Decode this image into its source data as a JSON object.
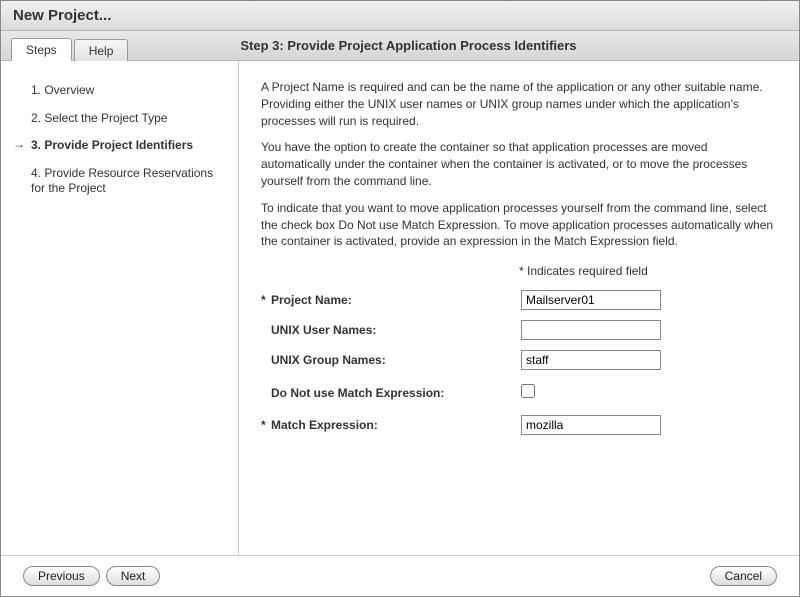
{
  "window": {
    "title": "New Project..."
  },
  "tabs": {
    "steps": "Steps",
    "help": "Help"
  },
  "stepTitle": "Step 3:   Provide Project Application Process Identifiers",
  "sidebar": {
    "items": [
      {
        "label": "1.  Overview"
      },
      {
        "label": "2.  Select the Project Type"
      },
      {
        "label": "3.  Provide Project Identifiers"
      },
      {
        "label": "4.  Provide Resource Reservations for the Project"
      }
    ]
  },
  "desc": {
    "p1": "A Project Name is required and can be the name of the application or any other suitable name. Providing either the UNIX user names or UNIX group names under which the application's processes will run is required.",
    "p2": "You have the option to create the container so that application processes are moved automatically under the container when the container is activated, or to move the processes yourself from the command line.",
    "p3": "To indicate that you want to move application processes yourself from the command line, select the check box Do Not use Match Expression. To move application processes automatically when the container is activated, provide an expression in the Match Expression field."
  },
  "requiredNote": "* Indicates required field",
  "fields": {
    "projectName": {
      "label": "Project Name:",
      "value": "Mailserver01"
    },
    "unixUsers": {
      "label": "UNIX User Names:",
      "value": ""
    },
    "unixGroups": {
      "label": "UNIX Group Names:",
      "value": "staff"
    },
    "noMatch": {
      "label": "Do Not use Match Expression:"
    },
    "matchExpr": {
      "label": "Match Expression:",
      "value": "mozilla"
    }
  },
  "buttons": {
    "previous": "Previous",
    "next": "Next",
    "cancel": "Cancel"
  }
}
